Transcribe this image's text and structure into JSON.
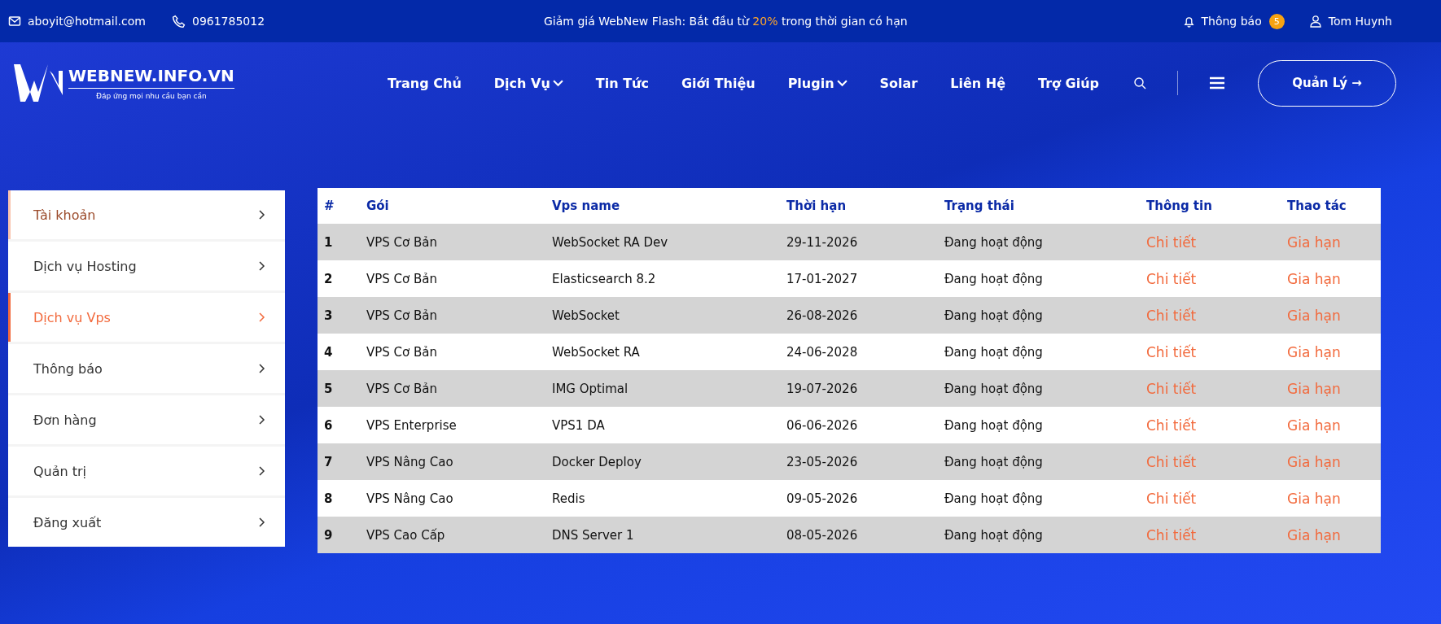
{
  "top_bar": {
    "email": "aboyit@hotmail.com",
    "phone": "0961785012",
    "promo": {
      "before": "Giảm giá WebNew Flash: Bắt đầu từ ",
      "highlight": "20%",
      "after": " trong thời gian có hạn"
    },
    "notifications": {
      "label": "Thông báo",
      "count": "5"
    },
    "user": "Tom Huynh"
  },
  "header": {
    "logo": {
      "title": "WEBNEW.INFO.VN",
      "tagline": "Đáp ứng mọi nhu cầu bạn cần"
    },
    "nav": [
      {
        "label": "Trang Chủ",
        "has_menu": false
      },
      {
        "label": "Dịch Vụ",
        "has_menu": true
      },
      {
        "label": "Tin Tức",
        "has_menu": false
      },
      {
        "label": "Giới Thiệu",
        "has_menu": false
      },
      {
        "label": "Plugin",
        "has_menu": true
      },
      {
        "label": "Solar",
        "has_menu": false
      },
      {
        "label": "Liên Hệ",
        "has_menu": false
      },
      {
        "label": "Trợ Giúp",
        "has_menu": false
      }
    ],
    "manage_button": "Quản Lý →"
  },
  "sidebar": {
    "items": [
      {
        "label": "Tài khoản",
        "selected": false,
        "hovered": true
      },
      {
        "label": "Dịch vụ Hosting",
        "selected": false,
        "hovered": false
      },
      {
        "label": "Dịch vụ Vps",
        "selected": true,
        "hovered": false
      },
      {
        "label": "Thông báo",
        "selected": false,
        "hovered": false
      },
      {
        "label": "Đơn hàng",
        "selected": false,
        "hovered": false
      },
      {
        "label": "Quản trị",
        "selected": false,
        "hovered": false
      },
      {
        "label": "Đăng xuất",
        "selected": false,
        "hovered": false
      }
    ]
  },
  "table": {
    "columns": [
      "#",
      "Gói",
      "Vps name",
      "Thời hạn",
      "Trạng thái",
      "Thông tin",
      "Thao tác"
    ],
    "rows": [
      {
        "index": "1",
        "package": "VPS Cơ Bản",
        "name": "WebSocket RA Dev",
        "expiry": "29-11-2026",
        "status": "Đang hoạt động",
        "info": "Chi tiết",
        "action": "Gia hạn"
      },
      {
        "index": "2",
        "package": "VPS Cơ Bản",
        "name": "Elasticsearch 8.2",
        "expiry": "17-01-2027",
        "status": "Đang hoạt động",
        "info": "Chi tiết",
        "action": "Gia hạn"
      },
      {
        "index": "3",
        "package": "VPS Cơ Bản",
        "name": "WebSocket",
        "expiry": "26-08-2026",
        "status": "Đang hoạt động",
        "info": "Chi tiết",
        "action": "Gia hạn"
      },
      {
        "index": "4",
        "package": "VPS Cơ Bản",
        "name": "WebSocket RA",
        "expiry": "24-06-2028",
        "status": "Đang hoạt động",
        "info": "Chi tiết",
        "action": "Gia hạn"
      },
      {
        "index": "5",
        "package": "VPS Cơ Bản",
        "name": "IMG Optimal",
        "expiry": "19-07-2026",
        "status": "Đang hoạt động",
        "info": "Chi tiết",
        "action": "Gia hạn"
      },
      {
        "index": "6",
        "package": "VPS Enterprise",
        "name": "VPS1 DA",
        "expiry": "06-06-2026",
        "status": "Đang hoạt động",
        "info": "Chi tiết",
        "action": "Gia hạn"
      },
      {
        "index": "7",
        "package": "VPS Nâng Cao",
        "name": "Docker Deploy",
        "expiry": "23-05-2026",
        "status": "Đang hoạt động",
        "info": "Chi tiết",
        "action": "Gia hạn"
      },
      {
        "index": "8",
        "package": "VPS Nâng Cao",
        "name": "Redis",
        "expiry": "09-05-2026",
        "status": "Đang hoạt động",
        "info": "Chi tiết",
        "action": "Gia hạn"
      },
      {
        "index": "9",
        "package": "VPS Cao Cấp",
        "name": "DNS Server 1",
        "expiry": "08-05-2026",
        "status": "Đang hoạt động",
        "info": "Chi tiết",
        "action": "Gia hạn"
      }
    ]
  }
}
